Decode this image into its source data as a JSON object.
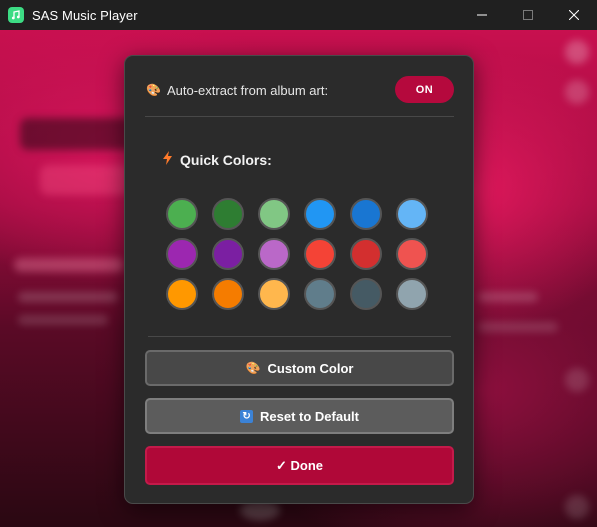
{
  "window": {
    "title": "SAS Music Player",
    "icon": "music-note-icon",
    "controls": [
      "minimize",
      "maximize",
      "close"
    ]
  },
  "dialog": {
    "auto_extract": {
      "icon": "palette-icon",
      "label": "Auto-extract from album art:",
      "toggle_label": "ON",
      "toggle_color": "#b5093d"
    },
    "quick_colors": {
      "icon": "lightning-icon",
      "title": "Quick Colors:",
      "swatches": [
        "#4caf50",
        "#2e7d32",
        "#81c784",
        "#2196f3",
        "#1976d2",
        "#64b5f6",
        "#9c27b0",
        "#7b1fa2",
        "#ba68c8",
        "#f44336",
        "#d32f2f",
        "#ef5350",
        "#ff9800",
        "#f57c00",
        "#ffb74d",
        "#607d8b",
        "#455a64",
        "#90a4ae"
      ]
    },
    "buttons": {
      "custom_color": {
        "icon": "palette-icon",
        "label": "Custom Color"
      },
      "reset": {
        "icon": "refresh-icon",
        "label": "Reset to Default"
      },
      "done": {
        "icon": "check-icon",
        "label": "✓ Done"
      }
    },
    "accent_color": "#b00838"
  }
}
